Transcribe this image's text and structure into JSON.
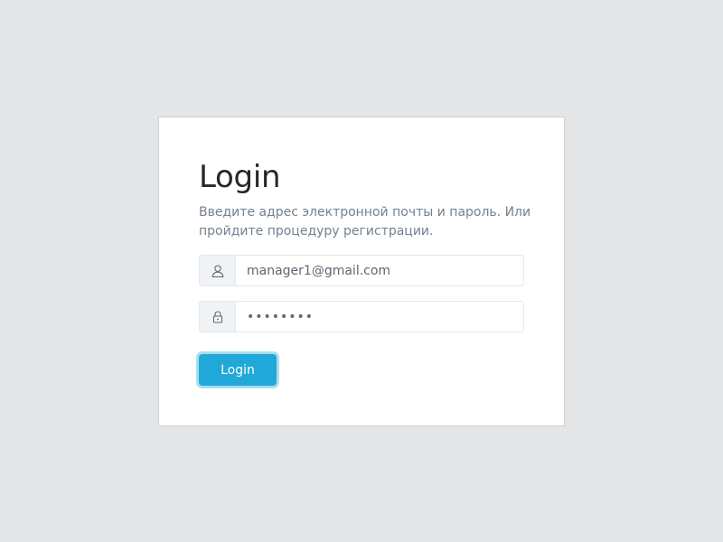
{
  "login_card": {
    "title": "Login",
    "subtitle": "Введите адрес электронной почты и пароль. Или пройдите процедуру регистрации.",
    "email": {
      "icon": "user-icon",
      "value": "manager1@gmail.com"
    },
    "password": {
      "icon": "lock-icon",
      "value": "********"
    },
    "login_button_label": "Login"
  },
  "colors": {
    "page_background": "#e4e5e6",
    "card_background": "#ffffff",
    "accent": "#20a8d8",
    "muted_text": "#73818f"
  }
}
